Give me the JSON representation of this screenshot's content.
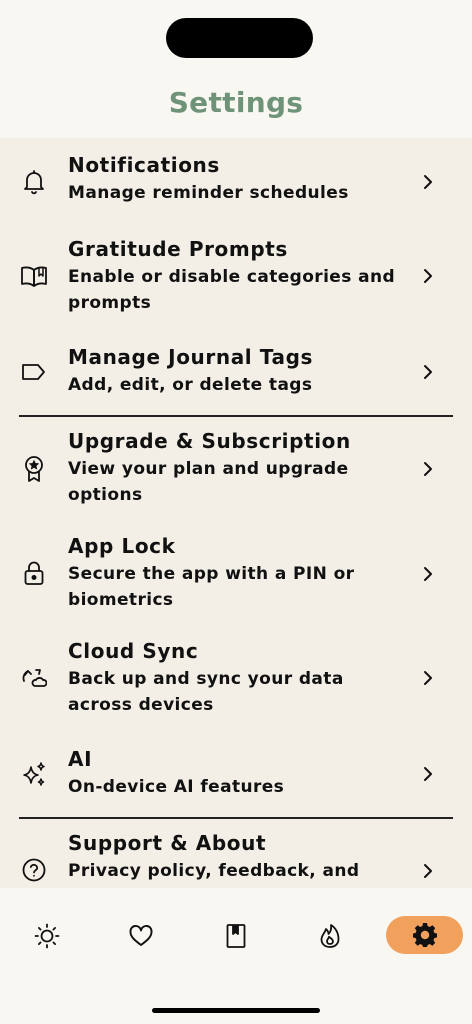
{
  "header": {
    "title": "Settings"
  },
  "settings": [
    {
      "title": "Notifications",
      "subtitle": "Manage reminder schedules",
      "icon": "bell-icon"
    },
    {
      "title": "Gratitude Prompts",
      "subtitle": "Enable or disable categories and prompts",
      "icon": "open-book-icon"
    },
    {
      "title": "Manage Journal Tags",
      "subtitle": "Add, edit, or delete tags",
      "icon": "tag-icon"
    },
    {
      "title": "Upgrade & Subscription",
      "subtitle": "View your plan and upgrade options",
      "icon": "award-badge-icon"
    },
    {
      "title": "App Lock",
      "subtitle": "Secure the app with a PIN or biometrics",
      "icon": "lock-icon"
    },
    {
      "title": "Cloud Sync",
      "subtitle": "Back up and sync your data across devices",
      "icon": "sync-icon"
    },
    {
      "title": "AI",
      "subtitle": "On-device AI features",
      "icon": "sparkles-icon"
    },
    {
      "title": "Support & About",
      "subtitle": "Privacy policy, feedback, and",
      "icon": "question-circle-icon"
    }
  ],
  "tabs": [
    {
      "name": "tab-today",
      "icon": "sun-icon",
      "active": false
    },
    {
      "name": "tab-favorites",
      "icon": "heart-icon",
      "active": false
    },
    {
      "name": "tab-journal",
      "icon": "bookmark-book-icon",
      "active": false
    },
    {
      "name": "tab-streak",
      "icon": "flame-icon",
      "active": false
    },
    {
      "name": "tab-settings",
      "icon": "gear-icon",
      "active": true
    }
  ],
  "colors": {
    "title": "#6f9378",
    "active_tab": "#f2a15d",
    "list_background": "#f3efe7",
    "page_background": "#f9f7f1"
  }
}
